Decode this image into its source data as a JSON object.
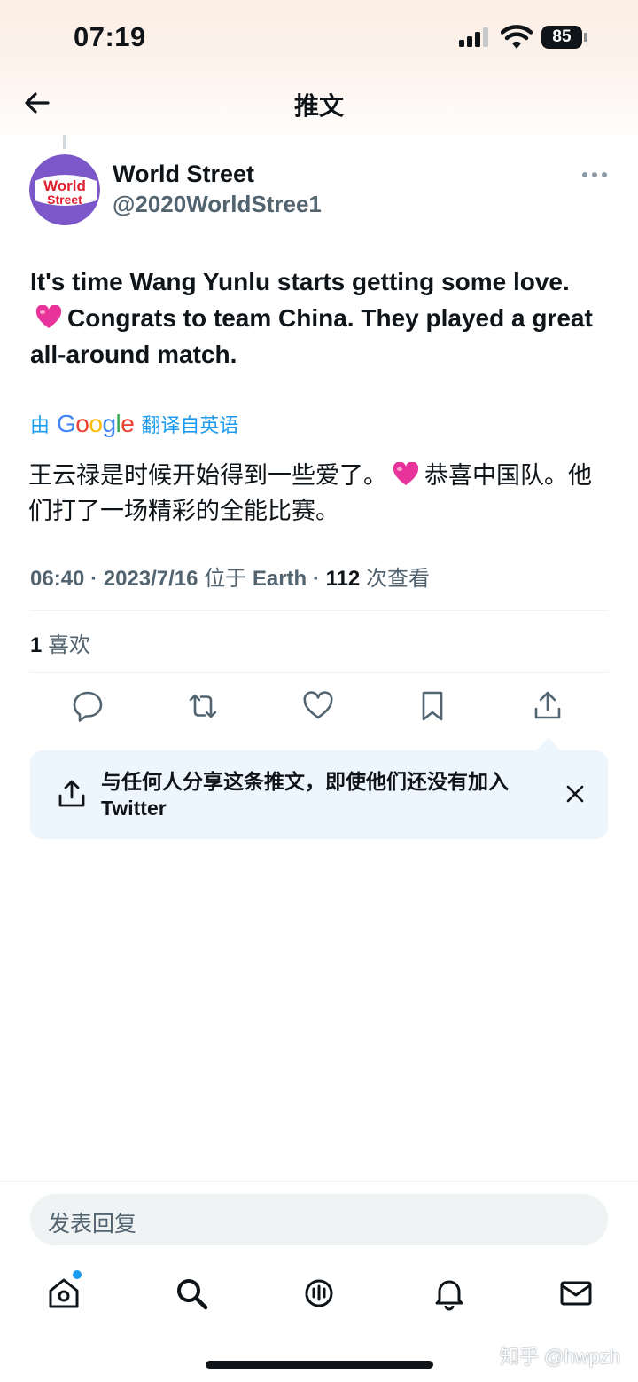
{
  "status_bar": {
    "time": "07:19",
    "battery": "85"
  },
  "nav": {
    "title": "推文",
    "back_icon": "arrow-left-icon"
  },
  "author": {
    "name": "World Street",
    "handle": "@2020WorldStree1",
    "avatar_line1": "World",
    "avatar_line2": "Street"
  },
  "tweet": {
    "text_part1": "It's time Wang Yunlu starts getting some love.",
    "text_part2": "Congrats to team China. They played a great all-around match."
  },
  "translation": {
    "by": "由",
    "google": "Google",
    "from": "翻译自英语",
    "text_part1": "王云禄是时候开始得到一些爱了。",
    "text_part2": "恭喜中国队。他们打了一场精彩的全能比赛。"
  },
  "meta": {
    "time": "06:40",
    "date": "2023/7/16",
    "location_prefix": "位于",
    "location": "Earth",
    "views": "112",
    "views_label": "次查看"
  },
  "likes": {
    "count": "1",
    "label": "喜欢"
  },
  "share_prompt": {
    "text": "与任何人分享这条推文，即使他们还没有加入 Twitter"
  },
  "reply": {
    "placeholder": "发表回复"
  },
  "tabs": [
    "home-icon",
    "search-icon",
    "spaces-icon",
    "notifications-icon",
    "messages-icon"
  ],
  "watermark": "知乎 @hwpzh",
  "colors": {
    "accent": "#1d9bf0",
    "secondary_text": "#536471",
    "share_bg": "#eef6fd",
    "heart": "#e8339a"
  }
}
